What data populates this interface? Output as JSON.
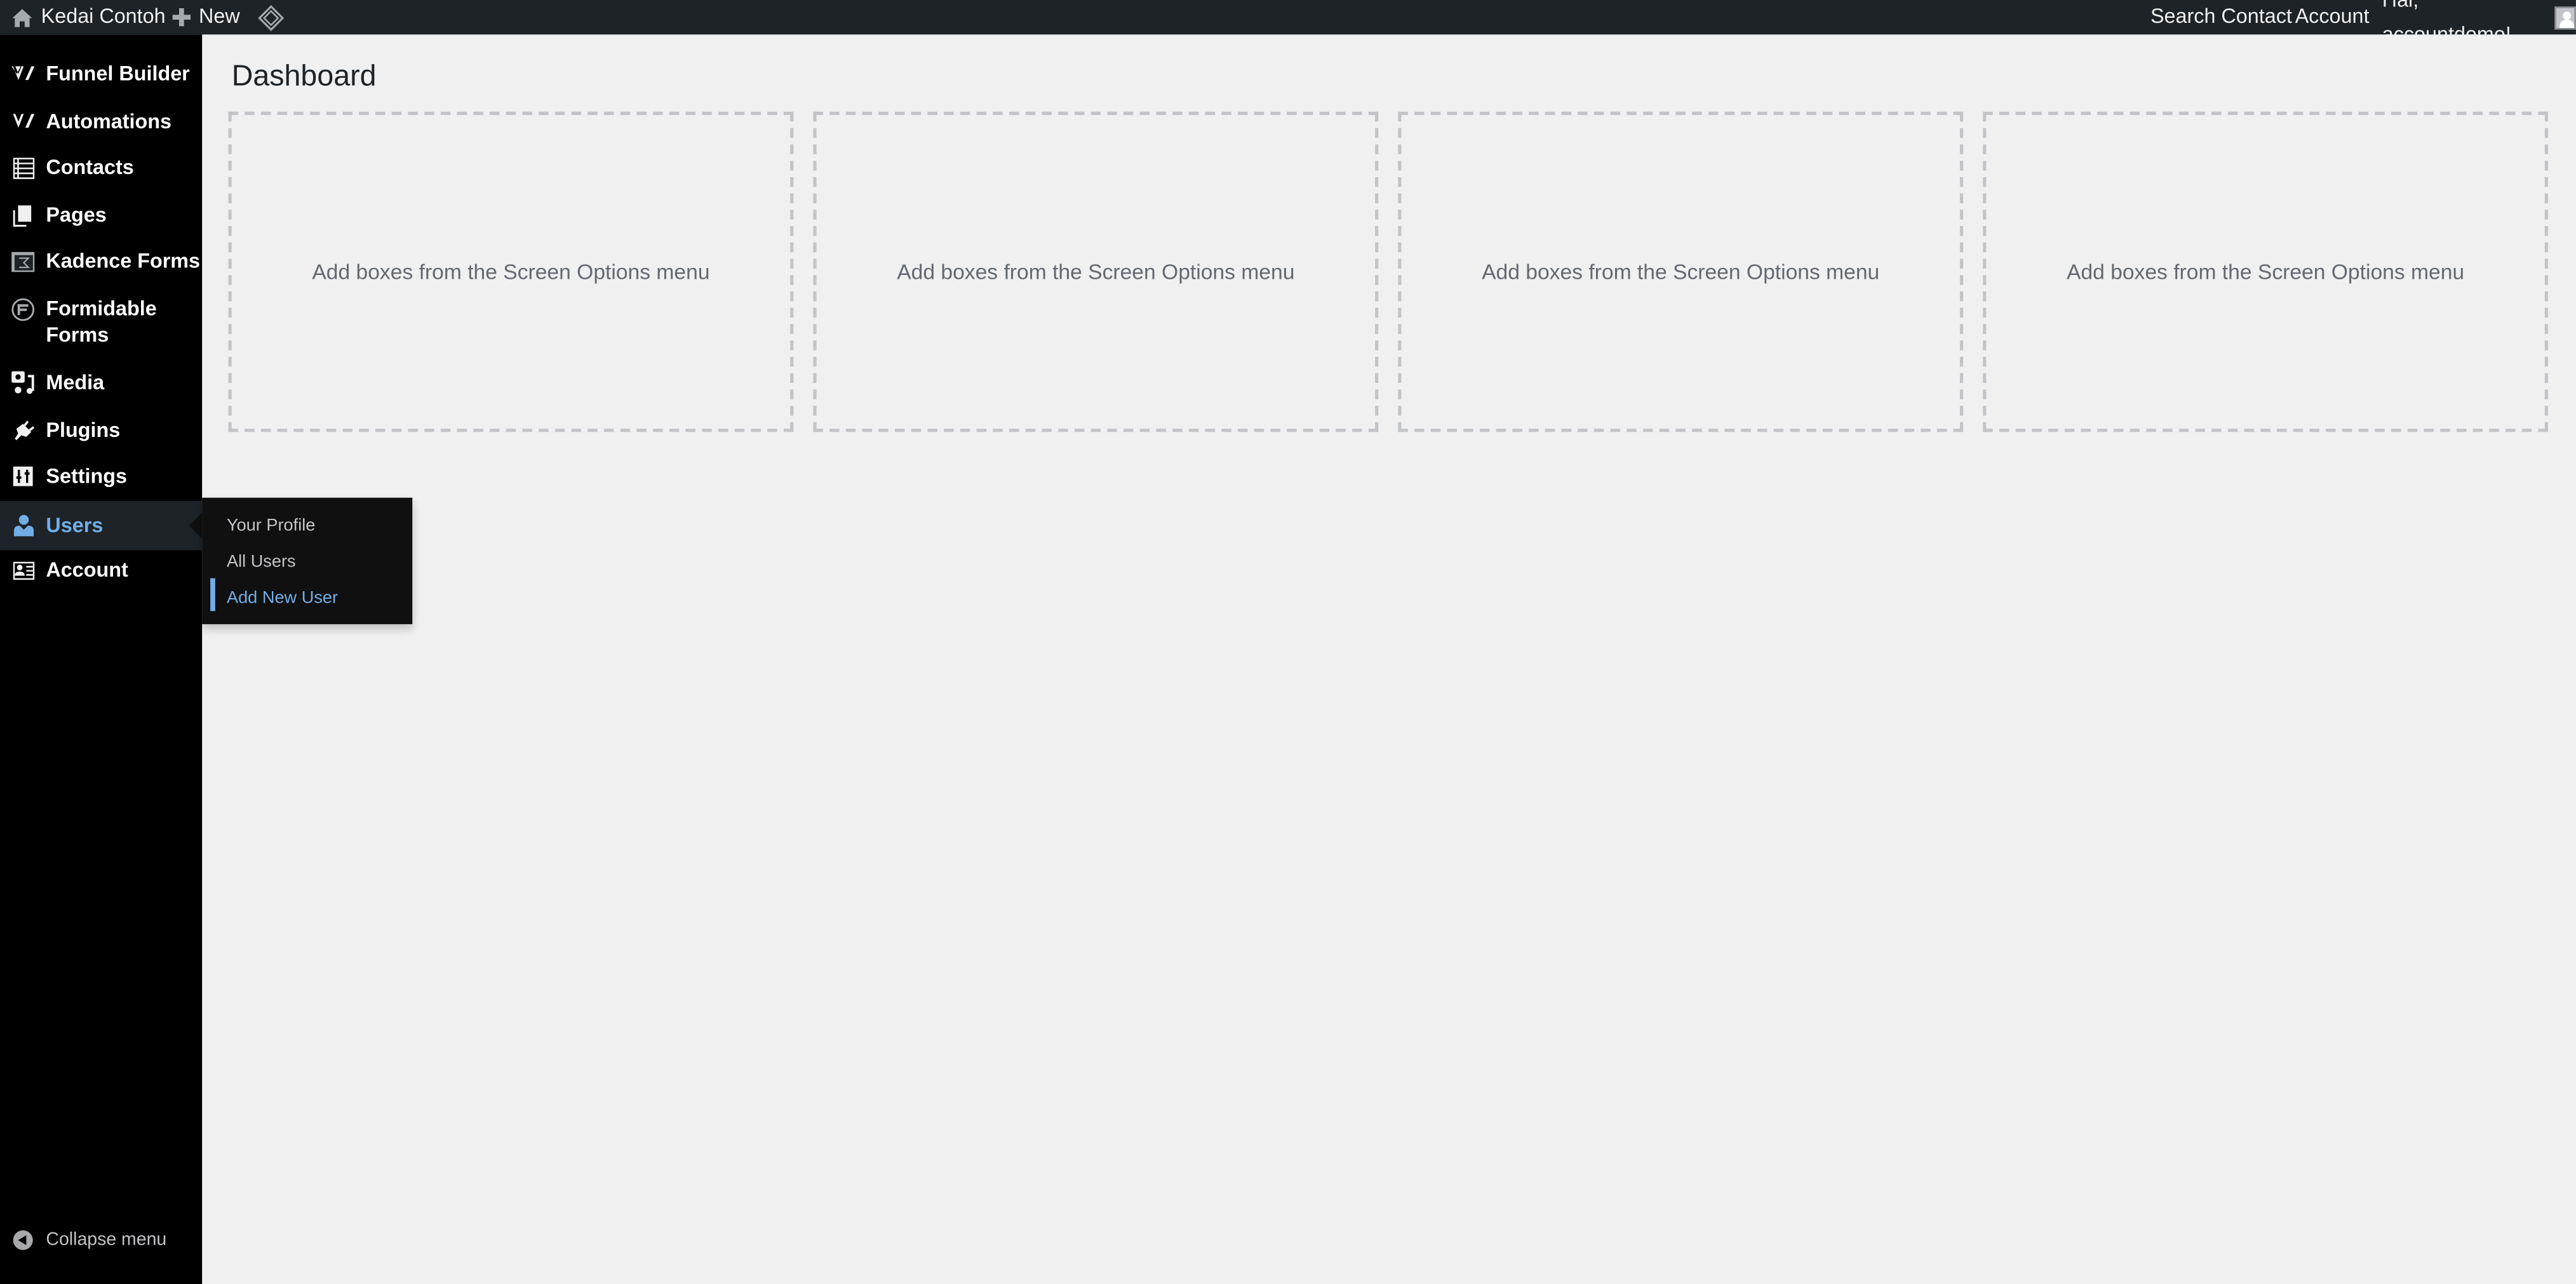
{
  "adminbar": {
    "site_name": "Kedai Contoh",
    "new_label": "New",
    "right_items": [
      "Search Contact",
      "Account"
    ],
    "greeting": "Hai, accountdemo!"
  },
  "sidebar": {
    "items": [
      {
        "label": "Funnel Builder",
        "icon": "funnel-builder-icon"
      },
      {
        "label": "Automations",
        "icon": "automations-icon"
      },
      {
        "label": "Contacts",
        "icon": "contacts-list-icon"
      },
      {
        "label": "Pages",
        "icon": "pages-icon"
      },
      {
        "label": "Kadence Forms",
        "icon": "kadence-forms-icon"
      },
      {
        "label": "Formidable Forms",
        "icon": "formidable-forms-icon"
      },
      {
        "label": "Media",
        "icon": "media-icon"
      },
      {
        "label": "Plugins",
        "icon": "plugins-icon"
      },
      {
        "label": "Settings",
        "icon": "settings-icon"
      },
      {
        "label": "Users",
        "icon": "users-icon",
        "active": true
      },
      {
        "label": "Account",
        "icon": "account-card-icon"
      }
    ],
    "collapse_label": "Collapse menu"
  },
  "users_submenu": {
    "items": [
      "Your Profile",
      "All Users",
      "Add New User"
    ],
    "current": "Add New User"
  },
  "main": {
    "title": "Dashboard",
    "placeholder_boxes": [
      "Add boxes from the Screen Options menu",
      "Add boxes from the Screen Options menu",
      "Add boxes from the Screen Options menu",
      "Add boxes from the Screen Options menu"
    ]
  },
  "colors": {
    "adminbar_bg": "#1d2327",
    "sidebar_bg": "#000000",
    "accent": "#72aee6",
    "page_bg": "#f0f0f1"
  }
}
